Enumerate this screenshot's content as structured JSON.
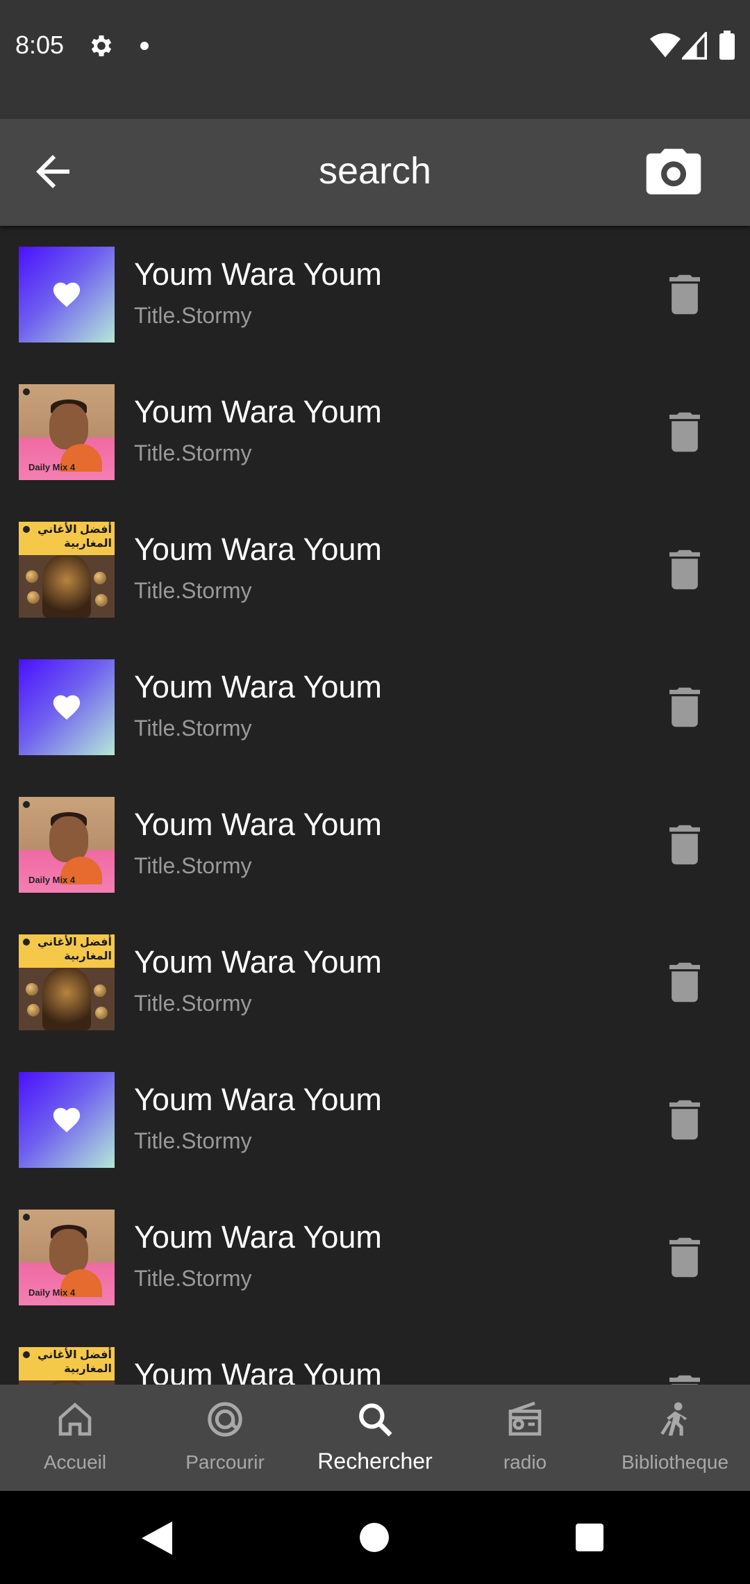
{
  "status_bar": {
    "time": "8:05",
    "icons": [
      "gear-icon",
      "notification-dot-icon",
      "wifi-icon",
      "signal-icon",
      "battery-icon"
    ]
  },
  "toolbar": {
    "title": "search",
    "back_icon": "arrow-left-icon",
    "camera_icon": "camera-icon"
  },
  "list": {
    "items": [
      {
        "title": "Youm Wara Youm",
        "subtitle": "Title.Stormy",
        "art": "liked"
      },
      {
        "title": "Youm Wara Youm",
        "subtitle": "Title.Stormy",
        "art": "daily-mix"
      },
      {
        "title": "Youm Wara Youm",
        "subtitle": "Title.Stormy",
        "art": "arab-hits"
      },
      {
        "title": "Youm Wara Youm",
        "subtitle": "Title.Stormy",
        "art": "liked"
      },
      {
        "title": "Youm Wara Youm",
        "subtitle": "Title.Stormy",
        "art": "daily-mix"
      },
      {
        "title": "Youm Wara Youm",
        "subtitle": "Title.Stormy",
        "art": "arab-hits"
      },
      {
        "title": "Youm Wara Youm",
        "subtitle": "Title.Stormy",
        "art": "liked"
      },
      {
        "title": "Youm Wara Youm",
        "subtitle": "Title.Stormy",
        "art": "daily-mix"
      },
      {
        "title": "Youm Wara Youm",
        "subtitle": "Title.Stormy",
        "art": "arab-hits"
      }
    ],
    "art_text": {
      "daily_mix": "Daily Mix 4",
      "arab_hits": "أفضل الأغاني المغاربية"
    },
    "delete_icon": "trash-icon"
  },
  "bottom_nav": {
    "items": [
      {
        "label": "Accueil",
        "icon": "home-icon",
        "active": false
      },
      {
        "label": "Parcourir",
        "icon": "browse-at-icon",
        "active": false
      },
      {
        "label": "Rechercher",
        "icon": "search-icon",
        "active": true
      },
      {
        "label": "radio",
        "icon": "radio-icon",
        "active": false
      },
      {
        "label": "Bibliotheque",
        "icon": "library-icon",
        "active": false
      }
    ]
  },
  "colors": {
    "background": "#222222",
    "toolbar": "#474747",
    "status_bar": "#353535",
    "subtitle": "#9a9a9a",
    "nav_inactive": "#a8a8a8"
  }
}
